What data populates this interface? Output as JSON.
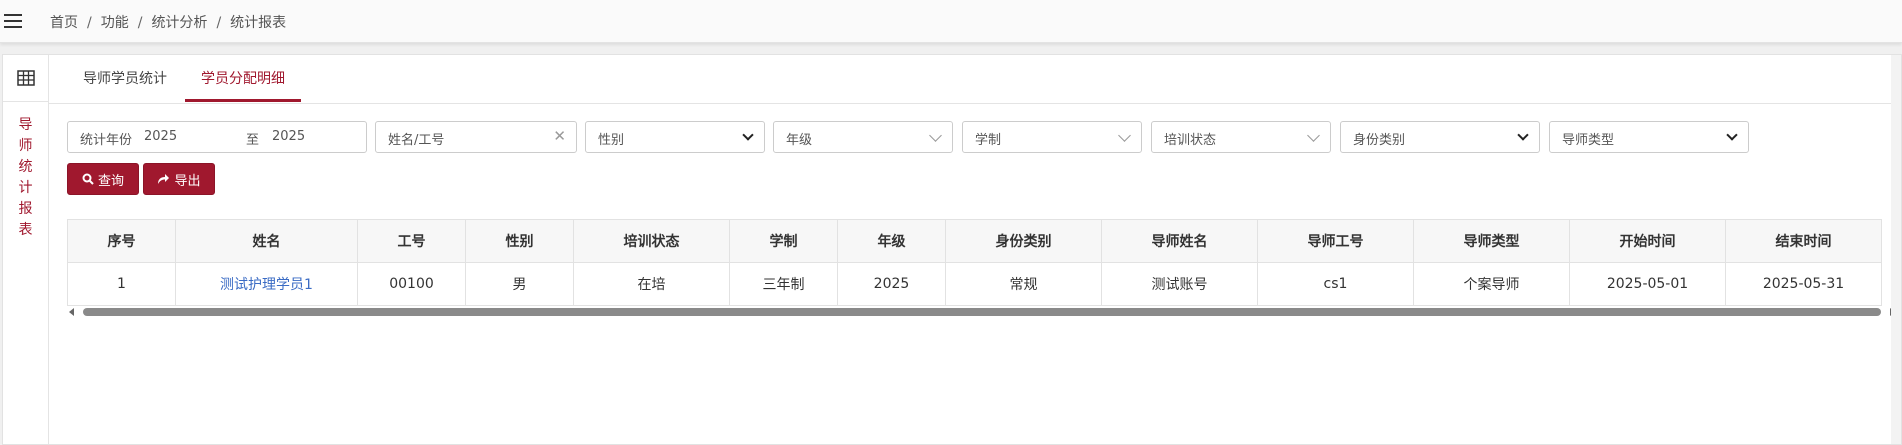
{
  "breadcrumb": [
    "首页",
    "功能",
    "统计分析",
    "统计报表"
  ],
  "sidebar": {
    "title_chars": [
      "导",
      "师",
      "统",
      "计",
      "报",
      "表"
    ]
  },
  "tabs": [
    {
      "label": "导师学员统计",
      "active": false
    },
    {
      "label": "学员分配明细",
      "active": true
    }
  ],
  "filters": {
    "year_label": "统计年份",
    "year_from": "2025",
    "year_to_label": "至",
    "year_to": "2025",
    "name_placeholder": "姓名/工号",
    "gender": "性别",
    "grade": "年级",
    "schooling": "学制",
    "training_status": "培训状态",
    "identity_type": "身份类别",
    "mentor_type": "导师类型"
  },
  "buttons": {
    "query": "查询",
    "export": "导出"
  },
  "table": {
    "headers": [
      "序号",
      "姓名",
      "工号",
      "性别",
      "培训状态",
      "学制",
      "年级",
      "身份类别",
      "导师姓名",
      "导师工号",
      "导师类型",
      "开始时间",
      "结束时间"
    ],
    "rows": [
      [
        "1",
        "测试护理学员1",
        "00100",
        "男",
        "在培",
        "三年制",
        "2025",
        "常规",
        "测试账号",
        "cs1",
        "个案导师",
        "2025-05-01",
        "2025-05-31"
      ]
    ]
  },
  "colors": {
    "accent": "#a0182e",
    "link": "#3a6bc4"
  }
}
